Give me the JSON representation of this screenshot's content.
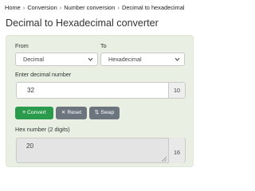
{
  "breadcrumb": {
    "items": [
      "Home",
      "Conversion",
      "Number conversion",
      "Decimal to hexadecimal"
    ],
    "separator": "›"
  },
  "page_title": "Decimal to Hexadecimal converter",
  "form": {
    "from_label": "From",
    "from_value": "Decimal",
    "to_label": "To",
    "to_value": "Hexadecimal",
    "input_label": "Enter decimal number",
    "input_value": "32",
    "input_base": "10",
    "convert_label": "Convert",
    "reset_label": "Reset",
    "swap_label": "Swap",
    "output_label": "Hex number (2 digits)",
    "output_value": "20",
    "output_base": "16"
  },
  "icons": {
    "convert": "equals-icon",
    "reset": "x-icon",
    "swap": "swap-icon",
    "select": "chevron-down-icon"
  },
  "colors": {
    "panel_bg": "#e9efe3",
    "convert_button": "#2a9a4b",
    "secondary_button": "#6c757d"
  }
}
